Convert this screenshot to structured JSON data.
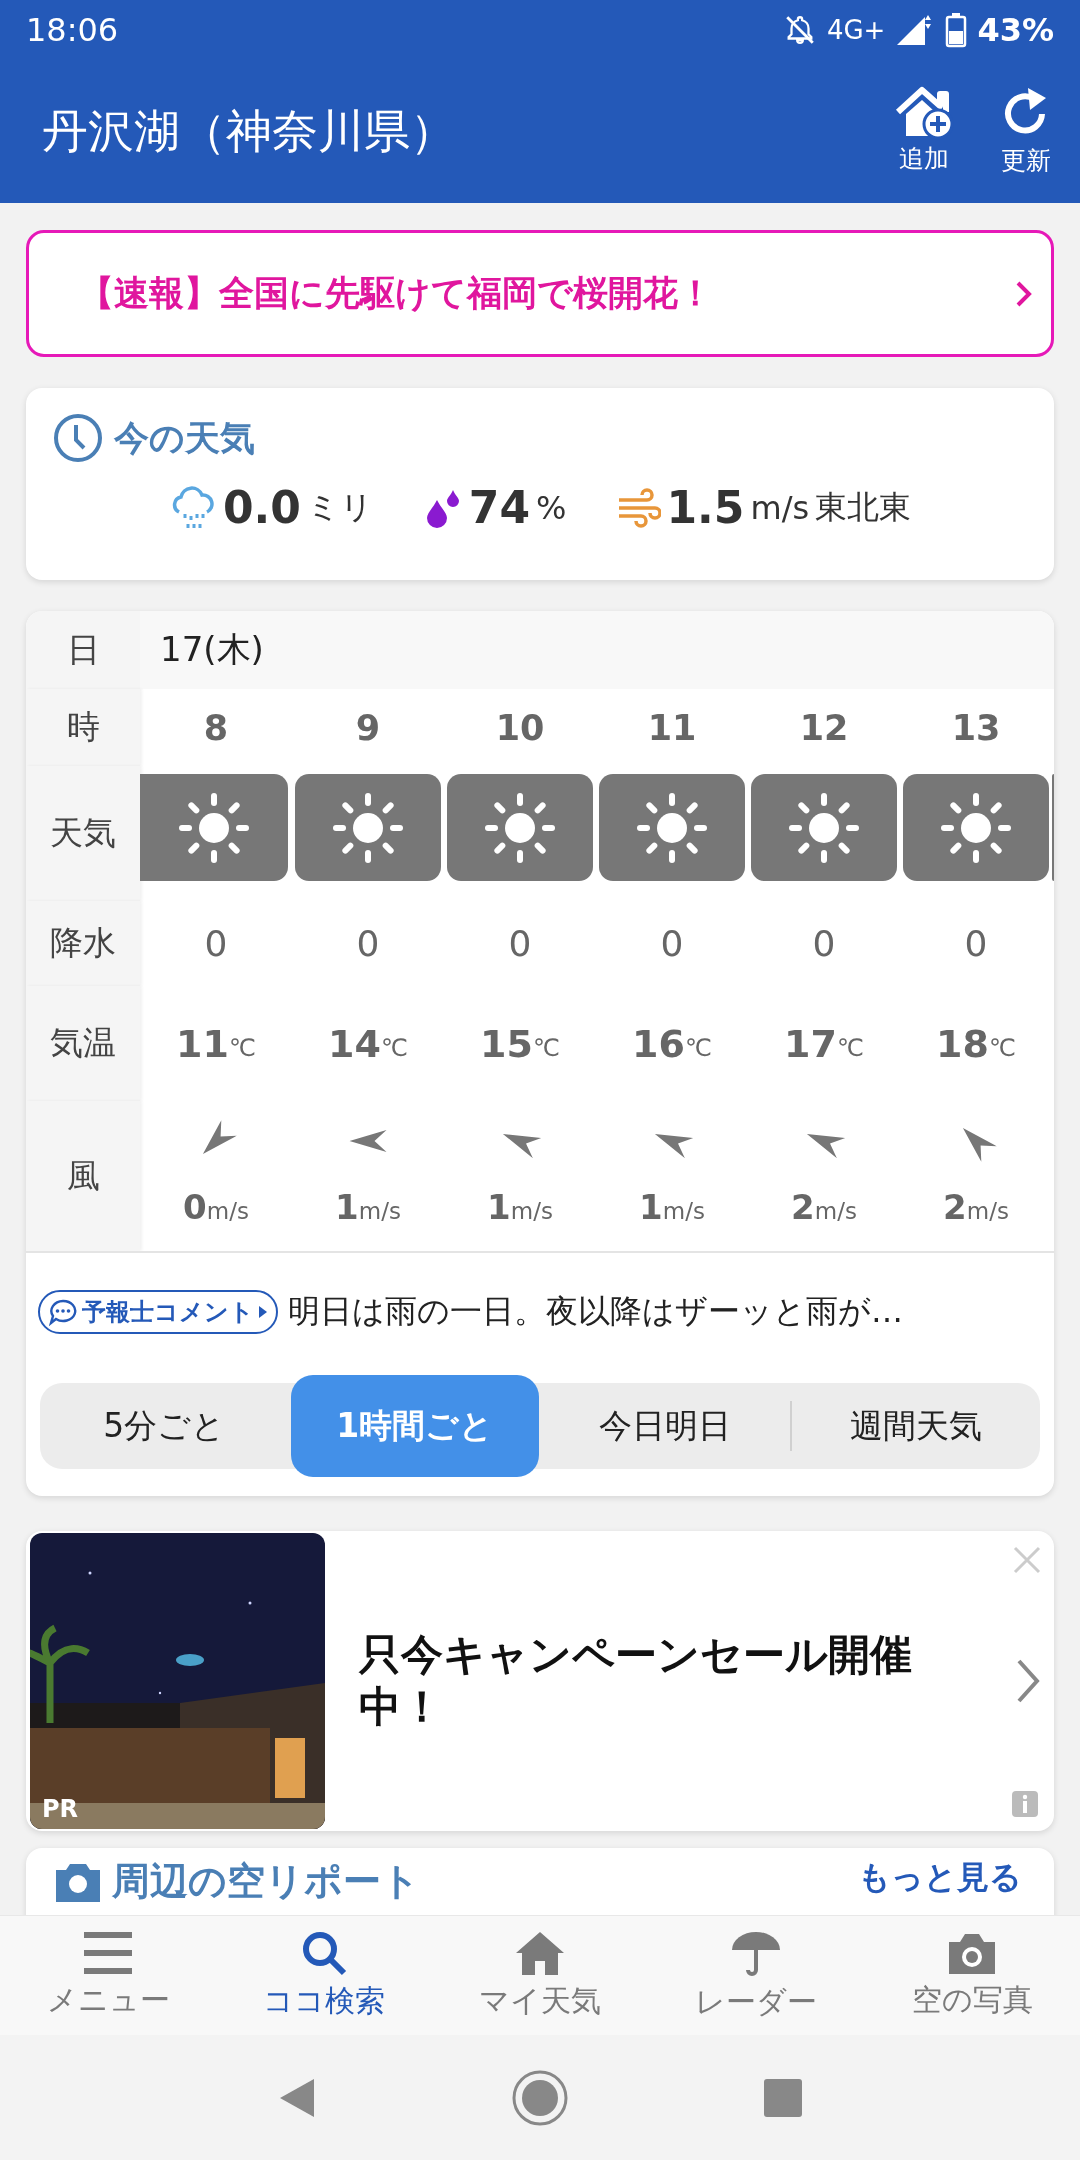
{
  "status_bar": {
    "time": "18:06",
    "network": "4G+",
    "battery": "43%"
  },
  "header": {
    "title": "丹沢湖（神奈川県）",
    "actions": [
      {
        "kind": "add",
        "label": "追加"
      },
      {
        "kind": "refresh",
        "label": "更新"
      }
    ]
  },
  "breaking_news": {
    "text": "【速報】全国に先駆けて福岡で桜開花！"
  },
  "current_weather": {
    "title": "今の天気",
    "precipitation": {
      "value": "0.0",
      "unit": "ミリ"
    },
    "humidity": {
      "value": "74",
      "unit": "%"
    },
    "wind": {
      "value": "1.5",
      "unit": "m/s",
      "direction": "東北東"
    }
  },
  "forecast": {
    "row_labels": {
      "date": "日",
      "hour": "時",
      "weather": "天気",
      "precipitation": "降水",
      "temperature": "気温",
      "wind": "風"
    },
    "date": "17(木)",
    "hours": [
      {
        "hour": "8",
        "kind": "sunny",
        "precipitation": "0",
        "temperature": "11",
        "temperature_unit": "℃",
        "wind_arrow": {
          "kind": "NE"
        },
        "wind_speed": "0",
        "wind_unit": "m/s"
      },
      {
        "hour": "9",
        "kind": "sunny",
        "precipitation": "0",
        "temperature": "14",
        "temperature_unit": "℃",
        "wind_arrow": {
          "kind": "E"
        },
        "wind_speed": "1",
        "wind_unit": "m/s"
      },
      {
        "hour": "10",
        "kind": "sunny",
        "precipitation": "0",
        "temperature": "15",
        "temperature_unit": "℃",
        "wind_arrow": {
          "kind": "ESE"
        },
        "wind_speed": "1",
        "wind_unit": "m/s"
      },
      {
        "hour": "11",
        "kind": "sunny",
        "precipitation": "0",
        "temperature": "16",
        "temperature_unit": "℃",
        "wind_arrow": {
          "kind": "ESE"
        },
        "wind_speed": "1",
        "wind_unit": "m/s"
      },
      {
        "hour": "12",
        "kind": "sunny",
        "precipitation": "0",
        "temperature": "17",
        "temperature_unit": "℃",
        "wind_arrow": {
          "kind": "ESE"
        },
        "wind_speed": "2",
        "wind_unit": "m/s"
      },
      {
        "hour": "13",
        "kind": "sunny",
        "precipitation": "0",
        "temperature": "18",
        "temperature_unit": "℃",
        "wind_arrow": {
          "kind": "SE"
        },
        "wind_speed": "2",
        "wind_unit": "m/s"
      }
    ]
  },
  "comment": {
    "badge": "予報士コメント",
    "text": "明日は雨の一日。夜以降はザーッと雨が…"
  },
  "tabs": [
    {
      "label": "5分ごと",
      "selected": false
    },
    {
      "label": "1時間ごと",
      "selected": true
    },
    {
      "label": "今日明日",
      "selected": false
    },
    {
      "label": "週間天気",
      "selected": false
    }
  ],
  "ad": {
    "badge": "PR",
    "headline": "只今キャンペーンセール開催中！"
  },
  "report_card": {
    "title": "周辺の空リポート",
    "more_link": "もっと見る"
  },
  "bottom_nav": [
    {
      "kind": "menu",
      "label": "メニュー",
      "selected": false
    },
    {
      "kind": "search",
      "label": "ココ検索",
      "selected": true
    },
    {
      "kind": "home",
      "label": "マイ天気",
      "selected": false
    },
    {
      "kind": "radar",
      "label": "レーダー",
      "selected": false
    },
    {
      "label": "空の写真",
      "selected": false
    }
  ]
}
